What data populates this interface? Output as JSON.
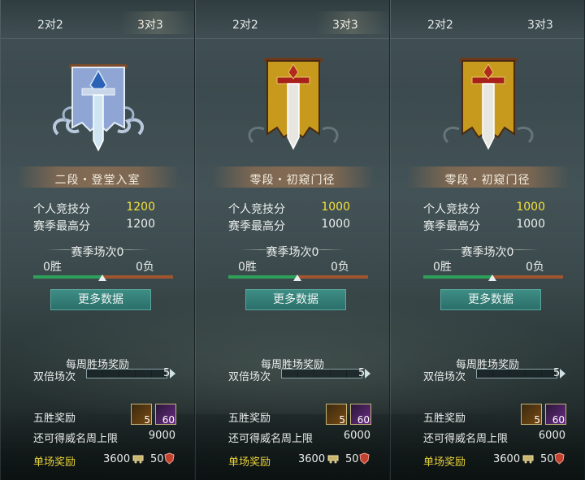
{
  "panels": [
    {
      "tabs": {
        "left": "2对2",
        "right": "3对3",
        "active": "right"
      },
      "emblem": {
        "type": "silver",
        "banner_color": "#8fa6d4",
        "sword_color": "#cfe6f2"
      },
      "rank": "二段・登堂入室",
      "personal_score_label": "个人竞技分",
      "personal_score_value": "1200",
      "season_best_label": "赛季最高分",
      "season_best_value": "1200",
      "season_matches": "赛季场次0",
      "wins": "0胜",
      "losses": "0负",
      "more_button": "更多数据",
      "weekly_title": "每周胜场奖励",
      "double_label": "双倍场次",
      "double_count": "5",
      "double_progress": 0.0,
      "five_win_label": "五胜奖励",
      "item1_count": "5",
      "item2_count": "60",
      "cap_label": "还可得威名周上限",
      "cap_value": "9000",
      "single_label": "单场奖励",
      "single_a": "3600",
      "single_b": "50"
    },
    {
      "tabs": {
        "left": "2对2",
        "right": "3对3",
        "active": "right"
      },
      "emblem": {
        "type": "gold",
        "banner_color": "#c79a1e",
        "sword_color": "#e8e6e0"
      },
      "rank": "零段・初窥门径",
      "personal_score_label": "个人竞技分",
      "personal_score_value": "1000",
      "season_best_label": "赛季最高分",
      "season_best_value": "1000",
      "season_matches": "赛季场次0",
      "wins": "0胜",
      "losses": "0负",
      "more_button": "更多数据",
      "weekly_title": "每周胜场奖励",
      "double_label": "双倍场次",
      "double_count": "5",
      "double_progress": 0.0,
      "five_win_label": "五胜奖励",
      "item1_count": "5",
      "item2_count": "60",
      "cap_label": "还可得威名周上限",
      "cap_value": "6000",
      "single_label": "单场奖励",
      "single_a": "3600",
      "single_b": "50"
    },
    {
      "tabs": {
        "left": "2对2",
        "right": "3对3",
        "active": "none"
      },
      "emblem": {
        "type": "gold",
        "banner_color": "#c79a1e",
        "sword_color": "#e8e6e0"
      },
      "rank": "零段・初窥门径",
      "personal_score_label": "个人竞技分",
      "personal_score_value": "1000",
      "season_best_label": "赛季最高分",
      "season_best_value": "1000",
      "season_matches": "赛季场次0",
      "wins": "0胜",
      "losses": "0负",
      "more_button": "更多数据",
      "weekly_title": "每周胜场奖励",
      "double_label": "双倍场次",
      "double_count": "5",
      "double_progress": 0.0,
      "five_win_label": "五胜奖励",
      "item1_count": "5",
      "item2_count": "60",
      "cap_label": "还可得威名周上限",
      "cap_value": "6000",
      "single_label": "单场奖励",
      "single_a": "3600",
      "single_b": "50"
    }
  ],
  "colors": {
    "highlight": "#f4e23c",
    "win_bar": "#2ea05a",
    "loss_bar": "#a0552e",
    "button": "#2b6f6a",
    "single_label": "#e7d23a"
  },
  "icons": {
    "item1": "treasure-chest-icon",
    "item2": "crystal-icon",
    "single_a": "cart-icon",
    "single_b": "shield-icon"
  }
}
